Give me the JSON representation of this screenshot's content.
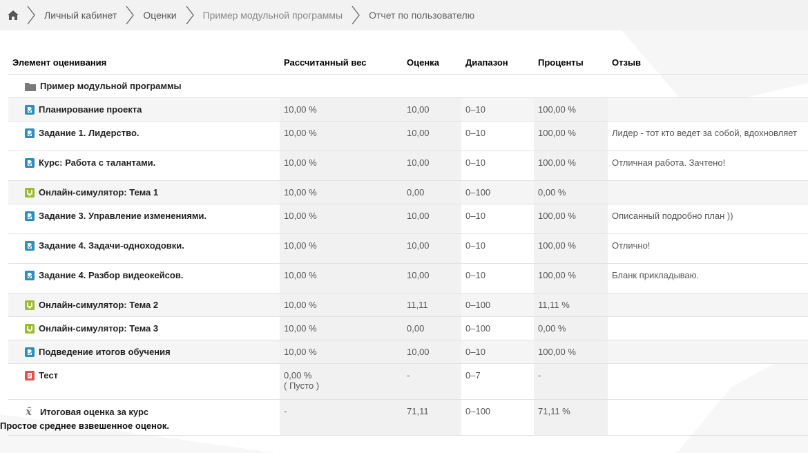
{
  "breadcrumb": {
    "home_icon": "home-icon",
    "items": [
      "Личный кабинет",
      "Оценки",
      "Пример модульной программы",
      "Отчет по пользователю"
    ]
  },
  "table": {
    "headers": {
      "item": "Элемент оценивания",
      "weight": "Рассчитанный вес",
      "grade": "Оценка",
      "range": "Диапазон",
      "percent": "Проценты",
      "feedback": "Отзыв"
    },
    "category": {
      "icon": "folder-icon",
      "name": "Пример модульной программы"
    },
    "rows": [
      {
        "icon": "assignment-icon",
        "name": "Планирование проекта",
        "weight": "10,00 %",
        "grade": "10,00",
        "range": "0–10",
        "percent": "100,00 %",
        "feedback": ""
      },
      {
        "icon": "assignment-icon",
        "name": "Задание 1. Лидерство.",
        "weight": "10,00 %",
        "grade": "10,00",
        "range": "0–10",
        "percent": "100,00 %",
        "feedback": "Лидер - тот кто ведет за собой, вдохновляет"
      },
      {
        "icon": "assignment-icon",
        "name": "Курс: Работа с талантами.",
        "weight": "10,00 %",
        "grade": "10,00",
        "range": "0–10",
        "percent": "100,00 %",
        "feedback": "Отличная работа. Зачтено!"
      },
      {
        "icon": "simulator-icon",
        "name": "Онлайн-симулятор: Тема 1",
        "weight": "10,00 %",
        "grade": "0,00",
        "range": "0–100",
        "percent": "0,00 %",
        "feedback": ""
      },
      {
        "icon": "assignment-icon",
        "name": "Задание 3. Управление изменениями.",
        "weight": "10,00 %",
        "grade": "10,00",
        "range": "0–10",
        "percent": "100,00 %",
        "feedback": "Описанный подробно план ))"
      },
      {
        "icon": "assignment-icon",
        "name": "Задание 4. Задачи-одноходовки.",
        "weight": "10,00 %",
        "grade": "10,00",
        "range": "0–10",
        "percent": "100,00 %",
        "feedback": "Отлично!"
      },
      {
        "icon": "assignment-icon",
        "name": "Задание 4. Разбор видеокейсов.",
        "weight": "10,00 %",
        "grade": "10,00",
        "range": "0–10",
        "percent": "100,00 %",
        "feedback": "Бланк прикладываю."
      },
      {
        "icon": "simulator-icon",
        "name": "Онлайн-симулятор: Тема 2",
        "weight": "10,00 %",
        "grade": "11,11",
        "range": "0–100",
        "percent": "11,11 %",
        "feedback": ""
      },
      {
        "icon": "simulator-icon",
        "name": "Онлайн-симулятор: Тема 3",
        "weight": "10,00 %",
        "grade": "0,00",
        "range": "0–100",
        "percent": "0,00 %",
        "feedback": ""
      },
      {
        "icon": "assignment-icon",
        "name": "Подведение итогов обучения",
        "weight": "10,00 %",
        "grade": "10,00",
        "range": "0–10",
        "percent": "100,00 %",
        "feedback": ""
      },
      {
        "icon": "quiz-icon",
        "name": "Тест",
        "weight": "0,00 %",
        "weight_note": "( Пусто )",
        "grade": "-",
        "range": "0–7",
        "percent": "-",
        "feedback": ""
      }
    ],
    "total": {
      "icon": "course-total-icon",
      "name": "Итоговая оценка за курс",
      "subtitle": "Простое среднее взвешенное оценок.",
      "weight": "-",
      "grade": "71,11",
      "range": "0–100",
      "percent": "71,11 %",
      "feedback": ""
    }
  },
  "colors": {
    "assignment": "#2f8fb8",
    "simulator": "#9dbb2a",
    "quiz": "#d9534f",
    "folder": "#7a7a7a"
  }
}
